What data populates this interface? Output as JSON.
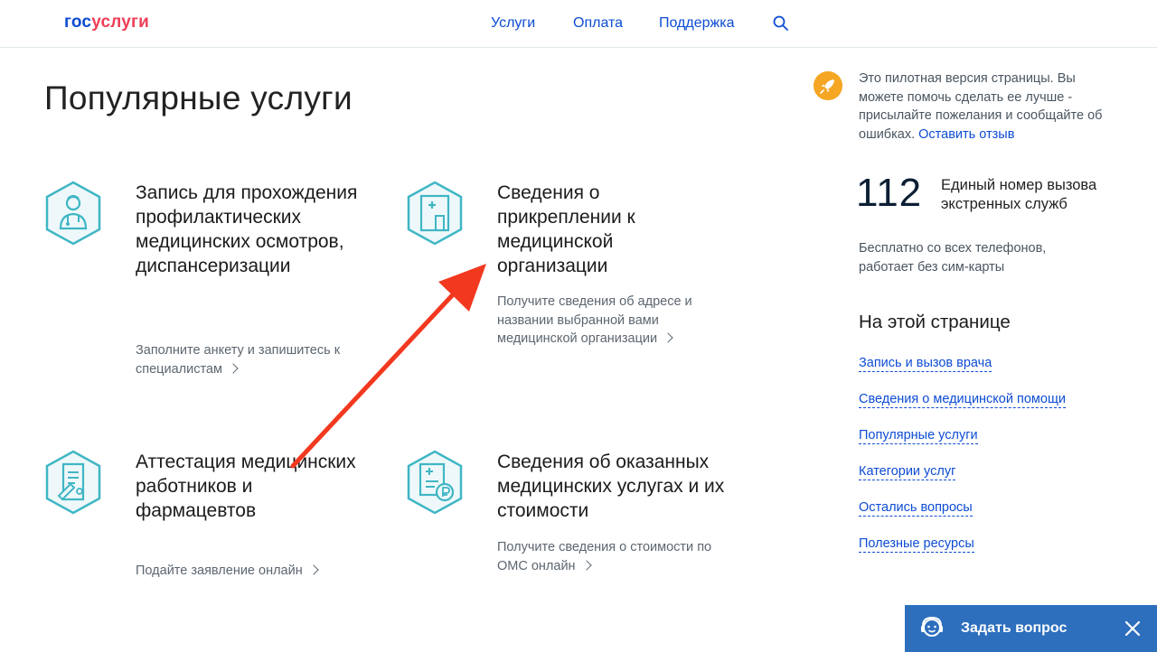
{
  "header": {
    "logo_part1": "гос",
    "logo_part2": "услуги",
    "nav": [
      "Услуги",
      "Оплата",
      "Поддержка"
    ],
    "search_icon": "search-icon"
  },
  "main": {
    "title": "Популярные услуги",
    "cards": [
      {
        "title": "Запись для прохождения профилактических медицинских осмотров, диспансеризации",
        "desc": "Заполните анкету и запишитесь к специалистам",
        "icon": "doctor-icon"
      },
      {
        "title": "Сведения о прикреплении к медицинской организации",
        "desc": "Получите сведения об адресе и названии выбранной вами медицинской организации",
        "icon": "hospital-building-icon"
      },
      {
        "title": "Аттестация медицинских работников и фармацевтов",
        "desc": "Подайте заявление онлайн",
        "icon": "certificate-icon"
      },
      {
        "title": "Сведения об оказанных медицинских услугах и их стоимости",
        "desc": "Получите сведения о стоимости по ОМС онлайн",
        "icon": "ruble-document-icon"
      }
    ]
  },
  "sidebar": {
    "pilot_text": "Это пилотная версия страницы. Вы можете помочь сделать ее лучше - присылайте пожелания и сообщайте об ошибках.",
    "pilot_link": "Оставить отзыв",
    "emergency_number": "112",
    "emergency_label": "Единый номер вызова экстренных служб",
    "emergency_note": "Бесплатно со всех телефонов, работает без сим-карты",
    "toc_title": "На этой странице",
    "toc_links": [
      "Запись и вызов врача",
      "Сведения о медицинской помощи",
      "Популярные услуги",
      "Категории услуг",
      "Остались вопросы",
      "Полезные ресурсы"
    ]
  },
  "ask_widget": {
    "label": "Задать вопрос"
  },
  "colors": {
    "brand_blue": "#0d4cd3",
    "brand_red": "#ee3f58",
    "icon_teal": "#3fb6c4",
    "annotation_arrow": "#f2391f",
    "widget_blue": "#2d6fbd"
  }
}
